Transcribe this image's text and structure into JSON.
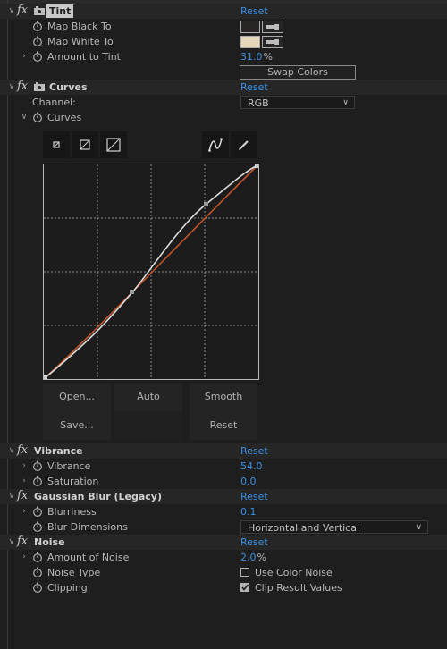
{
  "colors": {
    "accent_blue": "#3b8fe3",
    "bg": "#1e1e1e",
    "curve_white": "#dcdcdc",
    "curve_orange": "#c0542a"
  },
  "tint": {
    "name": "Tint",
    "reset": "Reset",
    "map_black_label": "Map Black To",
    "map_black_color": "#2a2525",
    "map_white_label": "Map White To",
    "map_white_color": "#e6d7b8",
    "amount_label": "Amount to Tint",
    "amount_value": "31.0",
    "amount_unit": "%",
    "swap_label": "Swap Colors"
  },
  "curves": {
    "name": "Curves",
    "reset": "Reset",
    "channel_label": "Channel:",
    "channel_value": "RGB",
    "curves_label": "Curves",
    "buttons": {
      "open": "Open...",
      "auto": "Auto",
      "smooth": "Smooth",
      "save": "Save...",
      "reset": "Reset"
    }
  },
  "vibrance": {
    "name": "Vibrance",
    "reset": "Reset",
    "vibrance_label": "Vibrance",
    "vibrance_value": "54.0",
    "saturation_label": "Saturation",
    "saturation_value": "0.0"
  },
  "gaussian": {
    "name": "Gaussian Blur (Legacy)",
    "reset": "Reset",
    "blurriness_label": "Blurriness",
    "blurriness_value": "0.1",
    "dimensions_label": "Blur Dimensions",
    "dimensions_value": "Horizontal and Vertical"
  },
  "noise": {
    "name": "Noise",
    "reset": "Reset",
    "amount_label": "Amount of Noise",
    "amount_value": "2.0",
    "amount_unit": "%",
    "type_label": "Noise Type",
    "type_checkbox_label": "Use Color Noise",
    "type_checked": false,
    "clipping_label": "Clipping",
    "clipping_checkbox_label": "Clip Result Values",
    "clipping_checked": true
  }
}
